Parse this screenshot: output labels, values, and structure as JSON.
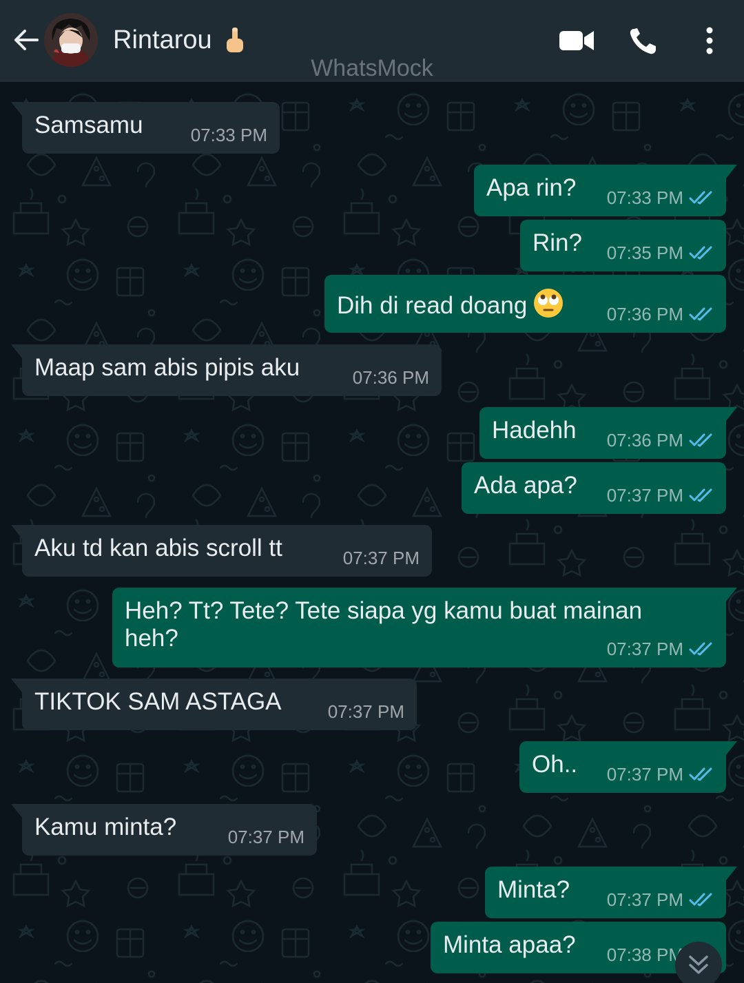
{
  "header": {
    "contact_name": "Rintarou",
    "watermark": "WhatsMock",
    "icons": [
      "back-arrow-icon",
      "avatar",
      "pointing-up-emoji",
      "video-call-icon",
      "voice-call-icon",
      "more-options-icon"
    ]
  },
  "colors": {
    "header": "#1f2c34",
    "chat_bg": "#0b141a",
    "incoming_bubble": "#1f2c34",
    "outgoing_bubble": "#005c4b",
    "read_tick": "#53bdeb"
  },
  "messages": [
    {
      "direction": "in",
      "text": "Samsamu",
      "time": "07:33 PM"
    },
    {
      "direction": "out",
      "text": "Apa rin?",
      "time": "07:33 PM",
      "status": "read"
    },
    {
      "direction": "out",
      "text": "Rin?",
      "time": "07:35 PM",
      "status": "read"
    },
    {
      "direction": "out",
      "text": "Dih di read doang",
      "time": "07:36 PM",
      "status": "read",
      "emoji": "face-with-rolling-eyes"
    },
    {
      "direction": "in",
      "text": "Maap sam abis pipis aku",
      "time": "07:36 PM"
    },
    {
      "direction": "out",
      "text": "Hadehh",
      "time": "07:36 PM",
      "status": "read"
    },
    {
      "direction": "out",
      "text": "Ada apa?",
      "time": "07:37 PM",
      "status": "read"
    },
    {
      "direction": "in",
      "text": "Aku td kan abis scroll tt",
      "time": "07:37 PM"
    },
    {
      "direction": "out",
      "text": "Heh? Tt? Tete? Tete siapa yg kamu buat mainan heh?",
      "time": "07:37 PM",
      "status": "read"
    },
    {
      "direction": "in",
      "text": "TIKTOK SAM ASTAGA",
      "time": "07:37 PM"
    },
    {
      "direction": "out",
      "text": "Oh..",
      "time": "07:37 PM",
      "status": "read"
    },
    {
      "direction": "in",
      "text": "Kamu minta?",
      "time": "07:37 PM"
    },
    {
      "direction": "out",
      "text": "Minta?",
      "time": "07:37 PM",
      "status": "read"
    },
    {
      "direction": "out",
      "text": "Minta apaa?",
      "time": "07:38 PM",
      "status": "read"
    }
  ],
  "scroll_button": {
    "icon": "double-chevron-down-icon"
  }
}
